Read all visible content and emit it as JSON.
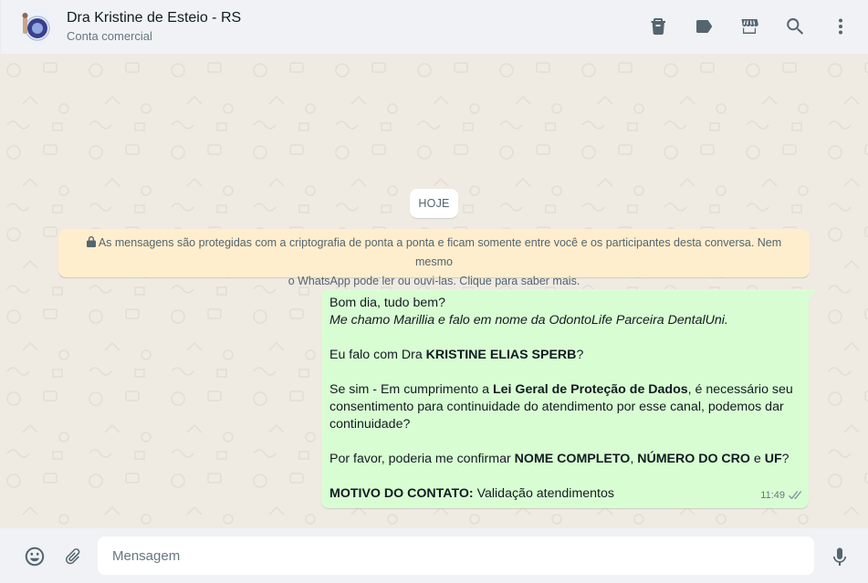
{
  "header": {
    "contact_name": "Dra Kristine de Esteio - RS",
    "contact_subtitle": "Conta comercial",
    "icons": [
      "trash-icon",
      "label-icon",
      "catalog-store-icon",
      "search-icon",
      "menu-icon"
    ]
  },
  "chat": {
    "date_separator": "HOJE",
    "encryption_notice_line1": "As mensagens são protegidas com a criptografia de ponta a ponta e ficam somente entre você e os participantes desta conversa. Nem mesmo",
    "encryption_notice_line2": "o WhatsApp pode ler ou ouvi-las. Clique para saber mais.",
    "message": {
      "line1": "Bom dia, tudo bem?",
      "line2": "Me chamo Marillia e falo em nome da OdontoLife Parceira DentalUni.",
      "line3_pre": "Eu falo com Dra ",
      "line3_bold": "KRISTINE ELIAS SPERB",
      "line3_post": "?",
      "line4_pre": "Se sim - Em cumprimento a ",
      "line4_bold": "Lei Geral de Proteção de Dados",
      "line4_post": ", é necessário seu consentimento para continuidade do atendimento por esse canal, podemos dar continuidade?",
      "line5_pre": "Por favor, poderia me confirmar ",
      "line5_bold1": "NOME COMPLETO",
      "line5_sep1": ", ",
      "line5_bold2": "NÚMERO DO CRO",
      "line5_sep2": " e ",
      "line5_bold3": "UF",
      "line5_post": "?",
      "line6_bold": "MOTIVO DO CONTATO:",
      "line6_post": " Validação atendimentos",
      "time": "11:49",
      "status": "delivered"
    }
  },
  "footer": {
    "input_placeholder": "Mensagem",
    "icons": [
      "emoji-icon",
      "attach-icon",
      "microphone-icon"
    ]
  },
  "colors": {
    "header_bg": "#f0f2f5",
    "chat_bg": "#efeae2",
    "outgoing_bubble": "#d9fdd3",
    "notice_bg": "#ffeecd",
    "icon": "#54656f"
  }
}
